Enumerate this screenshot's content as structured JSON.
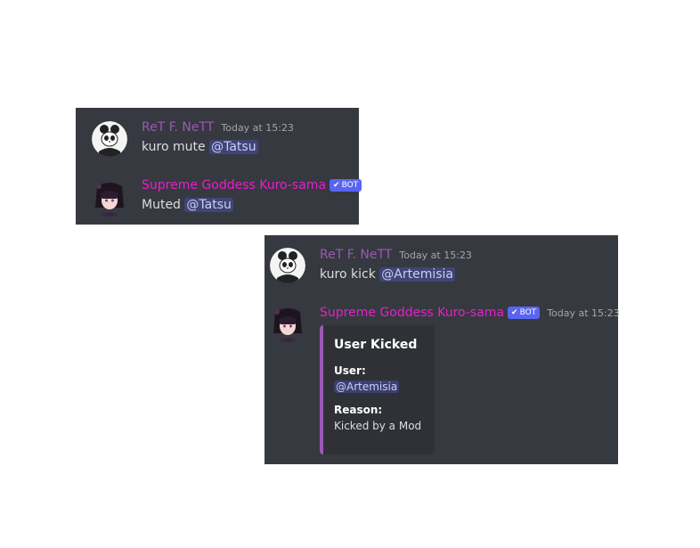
{
  "colors": {
    "panel_bg": "#36393f",
    "embed_bg": "#2f3136",
    "embed_accent": "#9b59b6",
    "ret_name": "#9b59b6",
    "kuro_name": "#e81ecc",
    "bot_badge": "#5865f2",
    "mention_text": "#c9cdfb",
    "message_text": "#dcddde"
  },
  "panel1": {
    "msg1": {
      "author": "ReT F. NeTT",
      "timestamp": "Today at 15:23",
      "text": "kuro mute",
      "mention": "@Tatsu",
      "avatar_icon": "panda-avatar-icon"
    },
    "msg2": {
      "author": "Supreme Goddess Kuro-sama",
      "badge": "BOT",
      "badge_icon": "check-icon",
      "text": "Muted",
      "mention": "@Tatsu",
      "avatar_icon": "anime-girl-avatar-icon"
    }
  },
  "panel2": {
    "msg1": {
      "author": "ReT F. NeTT",
      "timestamp": "Today at 15:23",
      "text": "kuro kick",
      "mention": "@Artemisia",
      "avatar_icon": "panda-avatar-icon"
    },
    "msg2": {
      "author": "Supreme Goddess Kuro-sama",
      "badge": "BOT",
      "badge_icon": "check-icon",
      "timestamp": "Today at 15:23",
      "avatar_icon": "anime-girl-avatar-icon",
      "embed": {
        "title": "User Kicked",
        "fields": [
          {
            "name": "User:",
            "value": "@Artemisia"
          },
          {
            "name": "Reason:",
            "value": "Kicked by a Mod"
          }
        ]
      }
    }
  }
}
